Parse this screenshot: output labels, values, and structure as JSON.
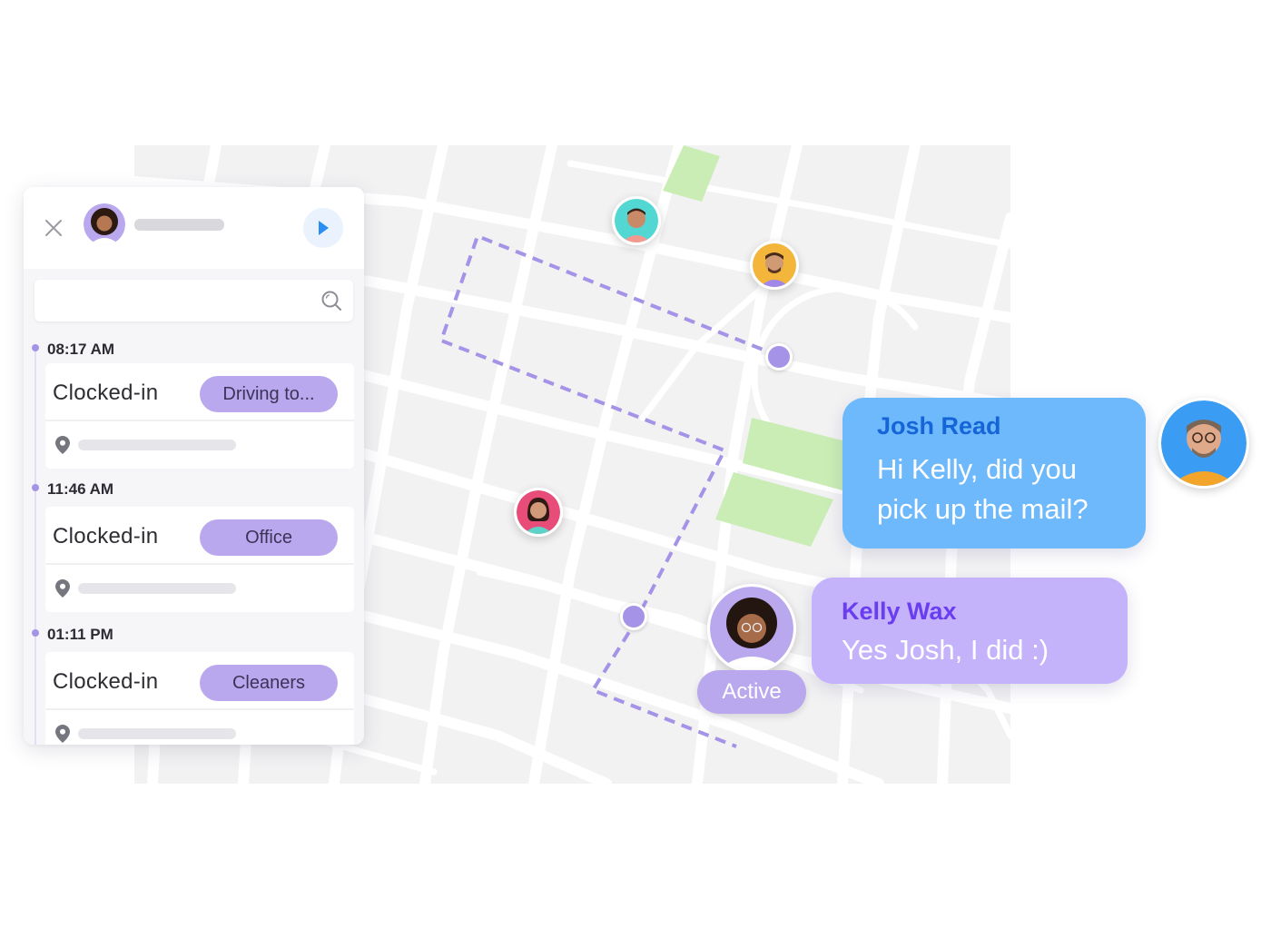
{
  "colors": {
    "accent": "#a593e7",
    "pill": "#b9a8ed",
    "map_background": "#f2f2f3",
    "map_roads": "#ffffff",
    "park": "#c9edb4",
    "josh_bubble": "#6eb9fb",
    "josh_name": "#1565d8",
    "kelly_bubble": "#c4b2fb",
    "kelly_name": "#6a3df0"
  },
  "panel": {
    "close_icon": "close-icon",
    "play_icon": "play-icon",
    "search": {
      "placeholder": "",
      "value": "",
      "icon": "search-icon"
    },
    "entries": [
      {
        "time": "08:17 AM",
        "status": "Clocked-in",
        "tag": "Driving to...",
        "location_icon": "location-pin-icon"
      },
      {
        "time": "11:46 AM",
        "status": "Clocked-in",
        "tag": "Office",
        "location_icon": "location-pin-icon"
      },
      {
        "time": "01:11 PM",
        "status": "Clocked-in",
        "tag": "Cleaners",
        "location_icon": "location-pin-icon"
      }
    ]
  },
  "map": {
    "user_markers": [
      "user-avatar",
      "user-avatar",
      "user-avatar"
    ],
    "route": "dashed-route"
  },
  "chat": {
    "josh": {
      "name": "Josh Read",
      "lines": [
        "Hi Kelly, did you",
        "pick up the mail?"
      ]
    },
    "kelly": {
      "name": "Kelly Wax",
      "message": "Yes Josh, I did :)",
      "status": "Active"
    }
  }
}
